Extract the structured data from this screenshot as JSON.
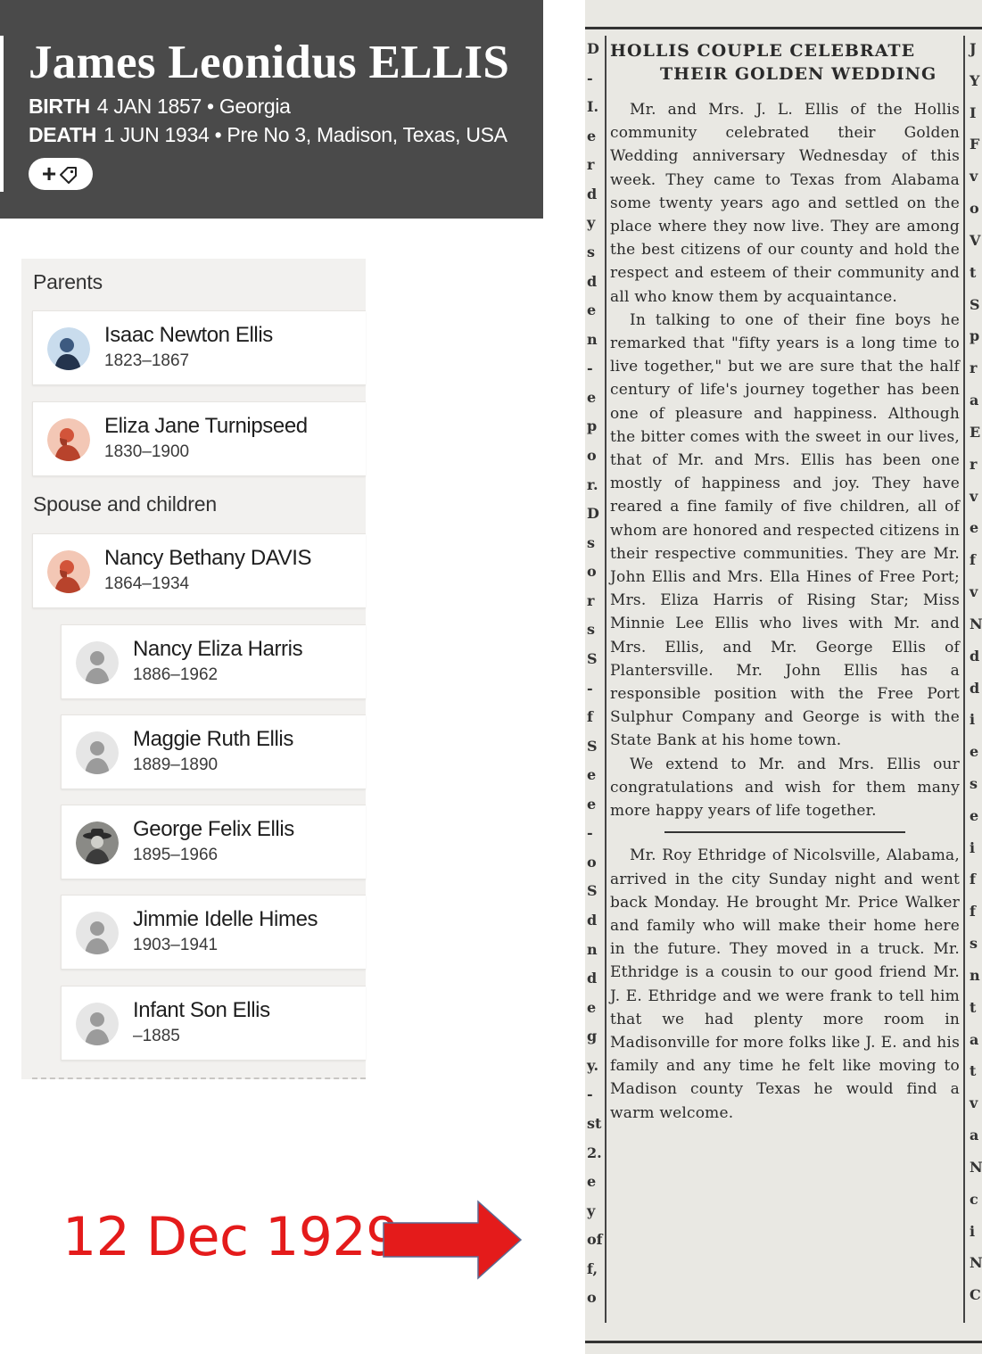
{
  "person": {
    "name": "James Leonidus ELLIS",
    "birth": {
      "label": "BIRTH",
      "value": "4 JAN 1857 • Georgia"
    },
    "death": {
      "label": "DEATH",
      "value": "1 JUN 1934 • Pre No 3, Madison, Texas, USA"
    },
    "add_tag_button": {
      "plus": "+",
      "icon": "tag-icon"
    }
  },
  "family": {
    "parents_label": "Parents",
    "parents": [
      {
        "name": "Isaac Newton Ellis",
        "dates": "1823–1867",
        "avatar": "male-silhouette-blue"
      },
      {
        "name": "Eliza Jane Turnipseed",
        "dates": "1830–1900",
        "avatar": "female-silhouette-orange"
      }
    ],
    "spouse_label": "Spouse and children",
    "spouse": {
      "name": "Nancy Bethany DAVIS",
      "dates": "1864–1934",
      "avatar": "female-silhouette-orange"
    },
    "children": [
      {
        "name": "Nancy Eliza Harris",
        "dates": "1886–1962",
        "avatar": "generic-silhouette-gray"
      },
      {
        "name": "Maggie Ruth Ellis",
        "dates": "1889–1890",
        "avatar": "generic-silhouette-gray"
      },
      {
        "name": "George Felix Ellis",
        "dates": "1895–1966",
        "avatar": "photo"
      },
      {
        "name": "Jimmie Idelle Himes",
        "dates": "1903–1941",
        "avatar": "generic-silhouette-gray"
      },
      {
        "name": "Infant Son Ellis",
        "dates": "–1885",
        "avatar": "generic-silhouette-gray"
      }
    ]
  },
  "annotation": {
    "date_text": "12 Dec 1929",
    "arrow": "right-arrow-icon",
    "color": "#e41b1b"
  },
  "clipping": {
    "headline_line1": "HOLLIS COUPLE CELEBRATE",
    "headline_line2": "THEIR GOLDEN WEDDING",
    "paragraph1": "Mr. and Mrs. J. L. Ellis of the Hollis community celebrated their Golden Wedding anniversary Wednesday of this week. They came to Texas from Alabama some twenty years ago and settled on the place where they now live. They are among the best citizens of our county and hold the respect and esteem of their community and all who know them by acquaintance.",
    "paragraph2": "In talking to one of their fine boys he remarked that \"fifty years is a long time to live together,\" but we are sure that the half century of life's journey together has been one of pleasure and happiness. Although the bitter comes with the sweet in our lives, that of Mr. and Mrs. Ellis has been one mostly of happiness and joy. They have reared a fine family of five children, all of whom are honored and respected citizens in their respective communities. They are Mr. John Ellis and Mrs. Ella Hines of Free Port; Mrs. Eliza Harris of Rising Star; Miss Minnie Lee Ellis who lives with Mr. and Mrs. Ellis, and Mr. George Ellis of Plantersville. Mr. John Ellis has a responsible position with the Free Port Sulphur Company and George is with the State Bank at his home town.",
    "paragraph3": "We extend to Mr. and Mrs. Ellis our congratulations and wish for them many more happy years of life together.",
    "paragraph4": "Mr. Roy Ethridge of Nicolsville, Alabama, arrived in the city Sunday night and went back Monday. He brought Mr. Price Walker and family who will make their home here in the future. They moved in a truck. Mr. Ethridge is a cousin to our good friend Mr. J. E. Ethridge and we were frank to tell him that we had plenty more room in Madisonville for more folks like J. E. and his family and any time he felt like moving to Madison county Texas he would find a warm welcome.",
    "left_strip": [
      "D",
      "-",
      "I.",
      "e",
      "r",
      "d",
      "y",
      "s",
      "d",
      "e",
      "n",
      "-",
      "e",
      "p",
      "o",
      "r.",
      "D",
      "s",
      "o",
      "r",
      "s",
      "S",
      "-",
      "f",
      "S",
      "e",
      "e",
      "-",
      "o",
      "S",
      "d",
      "n",
      "d",
      "e",
      "g",
      "y.",
      "-",
      "st",
      "2.",
      "e",
      "y",
      "of",
      "f,",
      "o"
    ],
    "right_strip": [
      "J",
      "Y",
      "I",
      "F",
      "v",
      "o",
      "V",
      "t",
      "S",
      "p",
      "r",
      "a",
      "E",
      "r",
      "v",
      "e",
      "f",
      "v",
      "N",
      "d",
      "d",
      "i",
      "e",
      "s",
      "e",
      "i",
      "f",
      "f",
      "s",
      "n",
      "t",
      "a",
      "t",
      "v",
      "a",
      "N",
      "c",
      "i",
      "N",
      "C"
    ]
  }
}
